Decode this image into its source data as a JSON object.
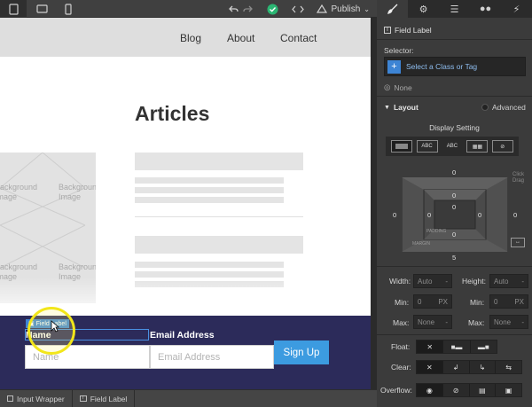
{
  "toolbar": {
    "publish_label": "Publish",
    "icons": [
      "desktop-icon",
      "tablet-landscape-icon",
      "phone-icon",
      "undo-icon",
      "redo-icon",
      "check-icon",
      "code-icon",
      "publish-icon"
    ]
  },
  "site": {
    "nav": [
      "Blog",
      "About",
      "Contact"
    ],
    "heading": "Articles",
    "bg_label": "Background Image",
    "form": {
      "tag_label": "Field Label",
      "name_label": "Name",
      "email_label": "Email Address",
      "name_placeholder": "Name",
      "email_placeholder": "Email Address",
      "button_label": "Sign Up"
    }
  },
  "breadcrumb": {
    "items": [
      "Input Wrapper",
      "Field Label"
    ]
  },
  "panel": {
    "header": "Field Label",
    "selector_label": "Selector:",
    "selector_placeholder": "Select a Class or Tag",
    "none_label": "None",
    "layout_label": "Layout",
    "advanced_label": "Advanced",
    "display_title": "Display Setting",
    "display_options": [
      "",
      "ABC",
      "ABC",
      "",
      ""
    ],
    "box_model": {
      "margin": {
        "top": "0",
        "right": "0",
        "bottom": "5",
        "left": "0"
      },
      "padding": {
        "top": "0",
        "right": "0",
        "bottom": "0",
        "left": "0"
      },
      "padding_label": "PADDING",
      "margin_label": "MARGIN",
      "clip_label": "Click Drag"
    },
    "width_label": "Width:",
    "width_value": "Auto",
    "height_label": "Height:",
    "height_value": "Auto",
    "min_label": "Min:",
    "min_w_value": "0",
    "min_w_unit": "PX",
    "min_h_value": "0",
    "min_h_unit": "PX",
    "max_label": "Max:",
    "max_w_value": "None",
    "max_h_value": "None",
    "float_label": "Float:",
    "clear_label": "Clear:",
    "overflow_label": "Overflow:"
  },
  "colors": {
    "accent": "#3d84d4",
    "form_band": "#2c2b5a",
    "signup": "#3c9be0",
    "panel_bg": "#3b3b3b"
  }
}
